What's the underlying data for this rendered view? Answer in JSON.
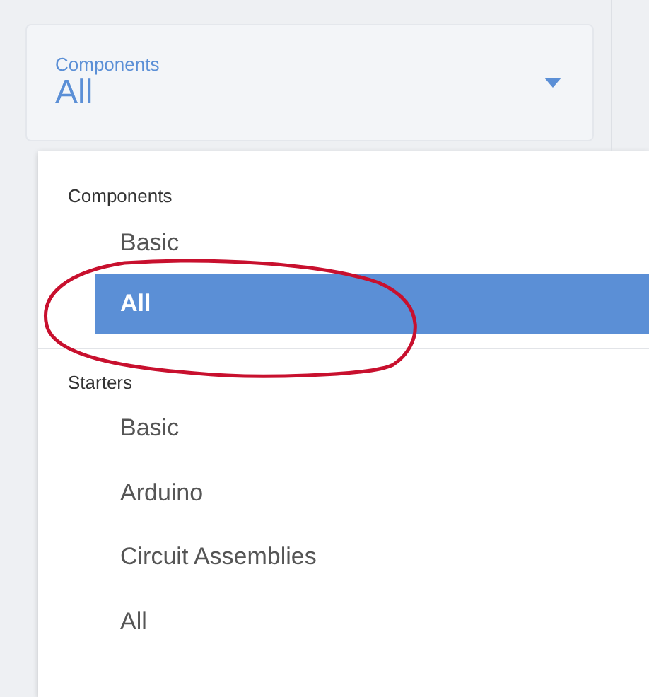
{
  "select": {
    "label": "Components",
    "value": "All"
  },
  "menu": [
    {
      "header": "Components",
      "items": [
        {
          "label": "Basic",
          "selected": false
        },
        {
          "label": "All",
          "selected": true
        }
      ]
    },
    {
      "header": "Starters",
      "items": [
        {
          "label": "Basic",
          "selected": false
        },
        {
          "label": "Arduino",
          "selected": false
        },
        {
          "label": "Circuit Assemblies",
          "selected": false
        },
        {
          "label": "All",
          "selected": false
        }
      ]
    }
  ]
}
